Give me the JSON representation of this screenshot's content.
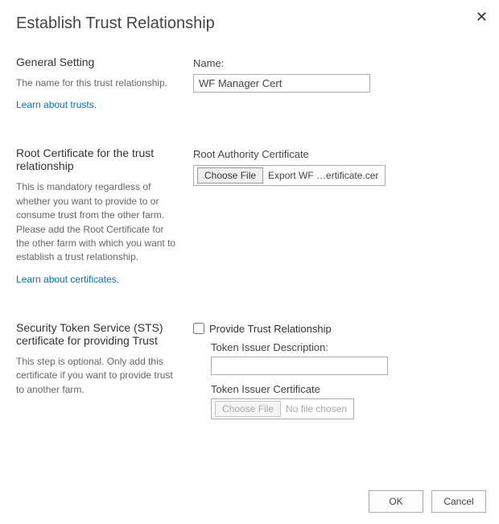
{
  "dialogTitle": "Establish Trust Relationship",
  "closeGlyph": "✕",
  "general": {
    "heading": "General Setting",
    "desc": "The name for this trust relationship.",
    "link": "Learn about trusts.",
    "nameLabel": "Name:",
    "nameValue": "WF Manager Cert"
  },
  "root": {
    "heading": "Root Certificate for the trust relationship",
    "desc": "This is mandatory regardless of whether you want to provide to or consume trust from the other farm. Please add the Root Certificate for the other farm with which you want to establish a trust relationship.",
    "link": "Learn about certificates.",
    "certLabel": "Root Authority Certificate",
    "chooseLabel": "Choose File",
    "fileName": "Export WF …ertificate.cer"
  },
  "sts": {
    "heading": "Security Token Service (STS) certificate for providing Trust",
    "desc": "This step is optional. Only add this certificate if you want to provide trust to another farm.",
    "checkboxLabel": "Provide Trust Relationship",
    "issuerDescLabel": "Token Issuer Description:",
    "issuerDescValue": "",
    "issuerCertLabel": "Token Issuer Certificate",
    "chooseLabel": "Choose File",
    "fileName": "No file chosen"
  },
  "footer": {
    "ok": "OK",
    "cancel": "Cancel"
  }
}
